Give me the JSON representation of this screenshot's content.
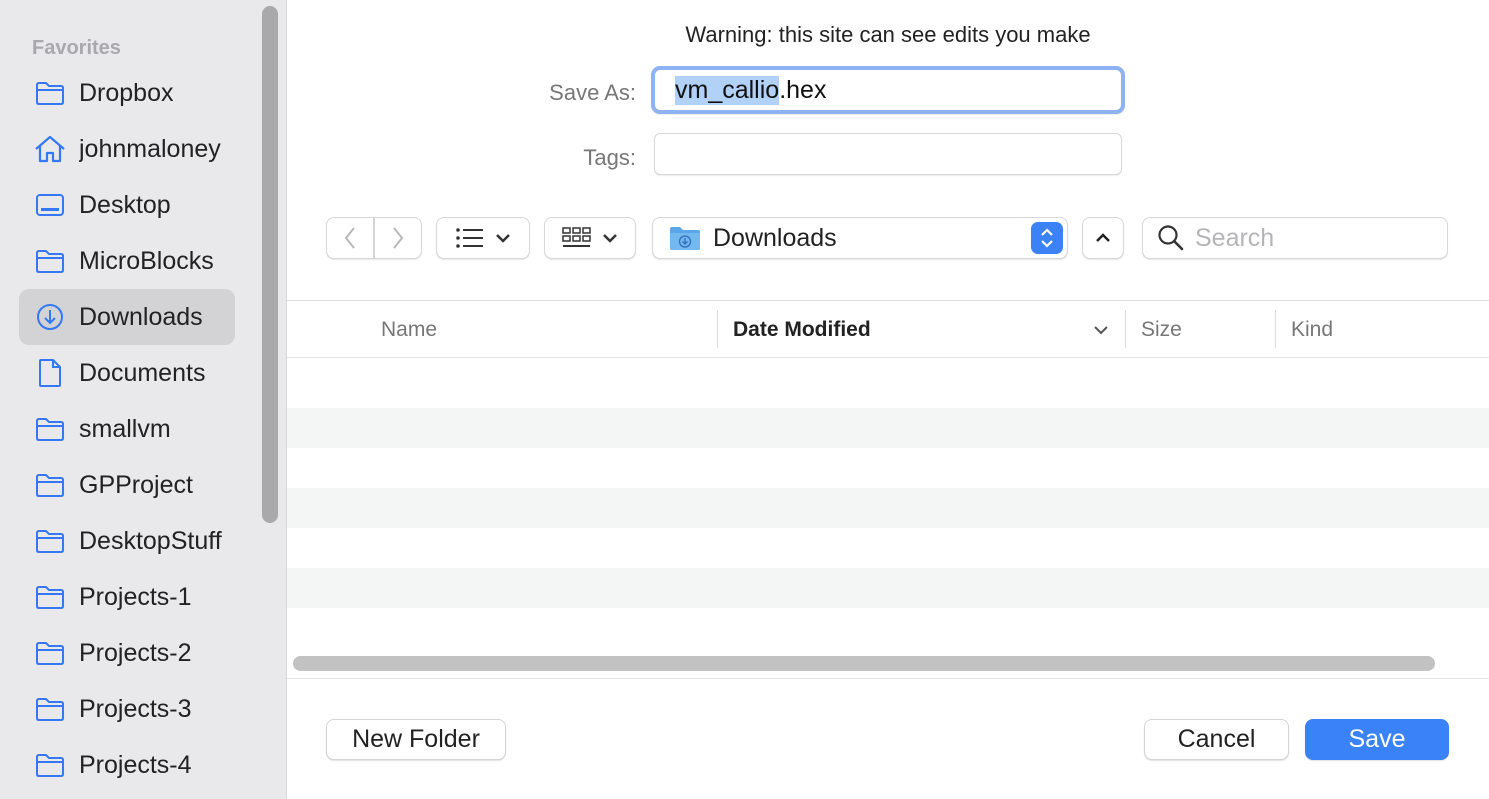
{
  "warning": "Warning: this site can see edits you make",
  "sidebar": {
    "heading": "Favorites",
    "items": [
      {
        "label": "Dropbox",
        "icon": "folder-icon"
      },
      {
        "label": "johnmaloney",
        "icon": "home-icon"
      },
      {
        "label": "Desktop",
        "icon": "desktop-icon"
      },
      {
        "label": "MicroBlocks",
        "icon": "folder-icon"
      },
      {
        "label": "Downloads",
        "icon": "downloads-icon",
        "selected": true
      },
      {
        "label": "Documents",
        "icon": "document-icon"
      },
      {
        "label": "smallvm",
        "icon": "folder-icon"
      },
      {
        "label": "GPProject",
        "icon": "folder-icon"
      },
      {
        "label": "DesktopStuff",
        "icon": "folder-icon"
      },
      {
        "label": "Projects-1",
        "icon": "folder-icon"
      },
      {
        "label": "Projects-2",
        "icon": "folder-icon"
      },
      {
        "label": "Projects-3",
        "icon": "folder-icon"
      },
      {
        "label": "Projects-4",
        "icon": "folder-icon"
      }
    ]
  },
  "save_as": {
    "label": "Save As:",
    "value_selected": "vm_callio",
    "value_rest": ".hex"
  },
  "tags": {
    "label": "Tags:",
    "value": ""
  },
  "toolbar": {
    "location": "Downloads",
    "search_placeholder": "Search"
  },
  "columns": {
    "name": "Name",
    "date_modified": "Date Modified",
    "size": "Size",
    "kind": "Kind"
  },
  "buttons": {
    "new_folder": "New Folder",
    "cancel": "Cancel",
    "save": "Save"
  },
  "colors": {
    "accent": "#3a82f7",
    "icon_blue": "#3478f6",
    "focus_ring": "#8db3f2",
    "selection": "#b2d1f7"
  }
}
